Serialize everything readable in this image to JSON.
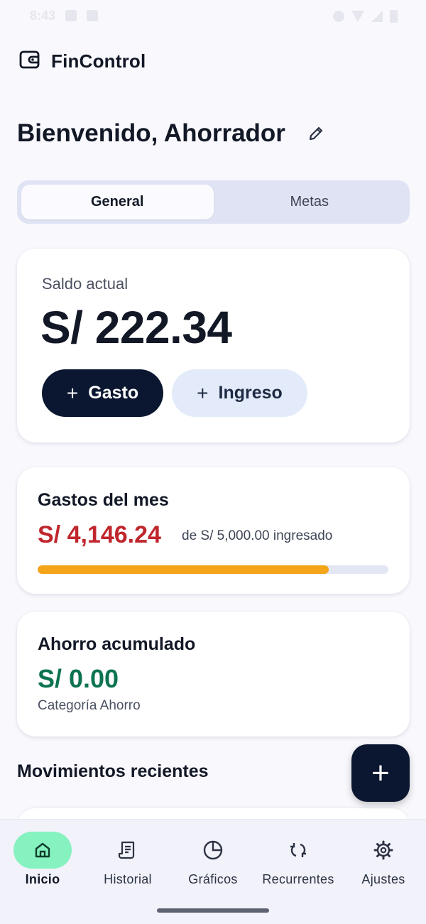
{
  "status_bar": {
    "time": "8:43"
  },
  "header": {
    "app_title": "FinControl",
    "logo_icon": "wallet-icon"
  },
  "welcome": {
    "text": "Bienvenido, Ahorrador",
    "edit_icon": "pencil-icon"
  },
  "tabs": [
    {
      "label": "General",
      "active": true
    },
    {
      "label": "Metas",
      "active": false
    }
  ],
  "balance": {
    "label": "Saldo actual",
    "value": "S/ 222.34",
    "expense_button": "Gasto",
    "income_button": "Ingreso",
    "plus_glyph": "+"
  },
  "monthly_expenses": {
    "title": "Gastos del mes",
    "amount": "S/ 4,146.24",
    "subtitle": "de S/ 5,000.00 ingresado",
    "progress": 0.8292,
    "progress_color": "#f4a419"
  },
  "savings": {
    "title": "Ahorro acumulado",
    "amount": "S/ 0.00",
    "subtitle": "Categoría Ahorro"
  },
  "recent": {
    "title": "Movimientos recientes"
  },
  "fab": {
    "glyph": "+"
  },
  "bottom_nav": [
    {
      "label": "Inicio",
      "icon": "home-icon",
      "active": true
    },
    {
      "label": "Historial",
      "icon": "receipt-icon",
      "active": false
    },
    {
      "label": "Gráficos",
      "icon": "pie-chart-icon",
      "active": false
    },
    {
      "label": "Recurrentes",
      "icon": "repeat-icon",
      "active": false
    },
    {
      "label": "Ajustes",
      "icon": "gear-icon",
      "active": false
    }
  ],
  "colors": {
    "primary_dark": "#0b1730",
    "expense_red": "#c0262d",
    "savings_green": "#0d7351",
    "active_nav": "#86f2bf"
  }
}
